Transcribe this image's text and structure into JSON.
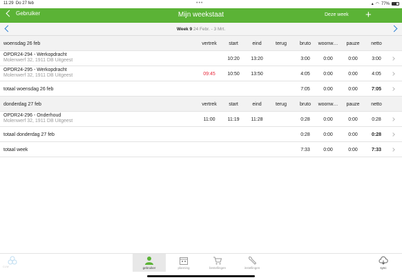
{
  "status": {
    "time": "11:29",
    "date": "Do 27 feb",
    "dots": "•••",
    "battery": "77%"
  },
  "nav": {
    "back_label": "Gebruiker",
    "title": "Mijn weekstaat",
    "week_button": "Deze week",
    "add": "+"
  },
  "weekbar": {
    "week": "Week 9",
    "range": "24 Febr. - 3 Mrt."
  },
  "columns": {
    "vertrek": "vertrek",
    "start": "start",
    "eind": "eind",
    "terug": "terug",
    "bruto": "bruto",
    "woon": "woonw…",
    "pauze": "pauze",
    "netto": "netto"
  },
  "day1": {
    "header": "woensdag 26 feb",
    "rows": [
      {
        "title": "OPDR24-294 - Werkopdracht",
        "address": "Molenwerf 32, 1911 DB  Uitgeest",
        "vertrek": "",
        "start": "10:20",
        "eind": "13:20",
        "terug": "",
        "bruto": "3:00",
        "woon": "0:00",
        "pauze": "0:00",
        "netto": "3:00"
      },
      {
        "title": "OPDR24-295 - Werkopdracht",
        "address": "Molenwerf 32, 1911 DB  Uitgeest",
        "vertrek": "09:45",
        "start": "10:50",
        "eind": "13:50",
        "terug": "",
        "bruto": "4:05",
        "woon": "0:00",
        "pauze": "0:00",
        "netto": "4:05"
      }
    ],
    "total": {
      "label": "totaal woensdag 26 feb",
      "bruto": "7:05",
      "woon": "0:00",
      "pauze": "0:00",
      "netto": "7:05"
    }
  },
  "day2": {
    "header": "donderdag 27 feb",
    "rows": [
      {
        "title": "OPDR24-296 - Onderhoud",
        "address": "Molenwerf 32, 1911 DB  Uitgeest",
        "vertrek": "11:00",
        "start": "11:19",
        "eind": "11:28",
        "terug": "",
        "bruto": "0:28",
        "woon": "0:00",
        "pauze": "0:00",
        "netto": "0:28"
      }
    ],
    "total": {
      "label": "totaal donderdag 27 feb",
      "bruto": "0:28",
      "woon": "0:00",
      "pauze": "0:00",
      "netto": "0:28"
    }
  },
  "week_total": {
    "label": "totaal week",
    "bruto": "7:33",
    "woon": "0:00",
    "pauze": "0:00",
    "netto": "7:33"
  },
  "tabbar": {
    "logo_text": "CLW",
    "tabs": [
      {
        "label": "gebruiker",
        "icon": "user-icon"
      },
      {
        "label": "planning",
        "icon": "calendar-icon"
      },
      {
        "label": "bestellingen",
        "icon": "cart-icon"
      },
      {
        "label": "instellingen",
        "icon": "wrench-icon"
      },
      {
        "label": "sync",
        "icon": "cloud-sync-icon"
      }
    ]
  },
  "colors": {
    "green": "#5bb336",
    "blue": "#2a7fd4",
    "red": "#e8273a"
  }
}
